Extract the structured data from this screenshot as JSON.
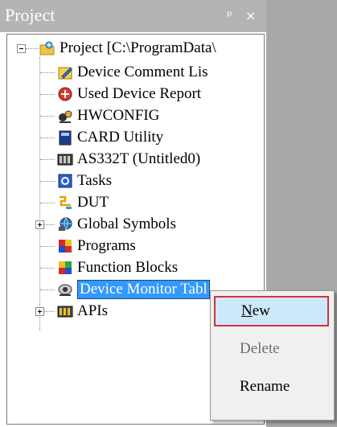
{
  "panel": {
    "title": "Project",
    "pin_glyph": "ᵖ",
    "close_glyph": "×"
  },
  "tree": {
    "root": {
      "label": "Project [C:\\ProgramData\\",
      "icon": "project-folder-icon"
    },
    "items": [
      {
        "label": "Device Comment Lis",
        "icon": "device-comment-icon",
        "expandable": false
      },
      {
        "label": "Used Device Report",
        "icon": "used-device-report-icon",
        "expandable": false
      },
      {
        "label": "HWCONFIG",
        "icon": "hwconfig-icon",
        "expandable": false
      },
      {
        "label": "CARD Utility",
        "icon": "card-utility-icon",
        "expandable": false
      },
      {
        "label": "AS332T  (Untitled0)",
        "icon": "plc-device-icon",
        "expandable": false
      },
      {
        "label": "Tasks",
        "icon": "tasks-icon",
        "expandable": false
      },
      {
        "label": "DUT",
        "icon": "dut-icon",
        "expandable": false
      },
      {
        "label": "Global Symbols",
        "icon": "global-symbols-icon",
        "expandable": true
      },
      {
        "label": "Programs",
        "icon": "programs-icon",
        "expandable": false
      },
      {
        "label": "Function Blocks",
        "icon": "function-blocks-icon",
        "expandable": false
      },
      {
        "label": "Device Monitor Tabl",
        "icon": "device-monitor-icon",
        "expandable": false,
        "selected": true
      },
      {
        "label": "APIs",
        "icon": "apis-icon",
        "expandable": true
      }
    ]
  },
  "context_menu": {
    "items": [
      {
        "label": "New",
        "state": "highlighted",
        "mnemonic": "N"
      },
      {
        "label": "Delete",
        "state": "disabled"
      },
      {
        "label": "Rename",
        "state": "normal"
      }
    ]
  }
}
